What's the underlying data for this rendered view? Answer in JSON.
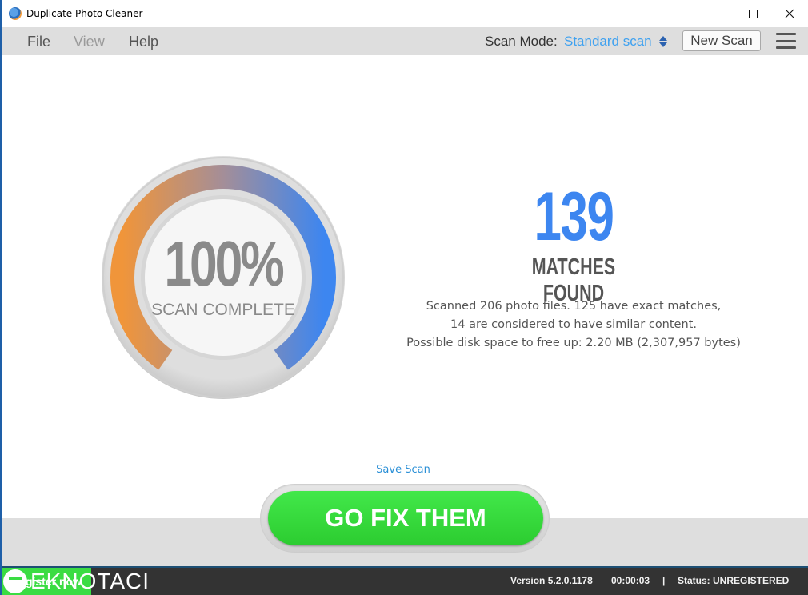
{
  "window": {
    "title": "Duplicate Photo Cleaner",
    "controls": {
      "minimize": "minimize",
      "maximize": "maximize",
      "close": "close"
    }
  },
  "menu": {
    "items": [
      {
        "label": "File",
        "enabled": true
      },
      {
        "label": "View",
        "enabled": false
      },
      {
        "label": "Help",
        "enabled": true
      }
    ],
    "scan_mode_label": "Scan Mode:",
    "scan_mode_value": "Standard scan",
    "new_scan_label": "New Scan"
  },
  "gauge": {
    "progress_percent": 100,
    "percent_text": "100%",
    "label": "SCAN COMPLETE",
    "colors": {
      "start": "#f0953a",
      "mid": "#a48e98",
      "end": "#3d86f0"
    }
  },
  "results": {
    "matches_count": "139",
    "matches_label": "MATCHES FOUND",
    "summary_lines": [
      "Scanned 206 photo files. 125 have exact matches,",
      "14 are considered to have similar content.",
      "Possible disk space to free up: 2.20 MB (2,307,957 bytes)"
    ]
  },
  "actions": {
    "save_scan_label": "Save Scan",
    "go_fix_label": "GO FIX THEM"
  },
  "statusbar": {
    "register_label": "Register now",
    "version": "Version 5.2.0.1178",
    "elapsed": "00:00:03",
    "separator": "|",
    "status": "Status: UNREGISTERED"
  },
  "watermark": {
    "text": "EKNOTACI"
  },
  "colors": {
    "accent_blue": "#3d86f0",
    "link_blue": "#3ea1f0",
    "go_green": "#36dd3c",
    "statusbar_bg": "#333333"
  }
}
